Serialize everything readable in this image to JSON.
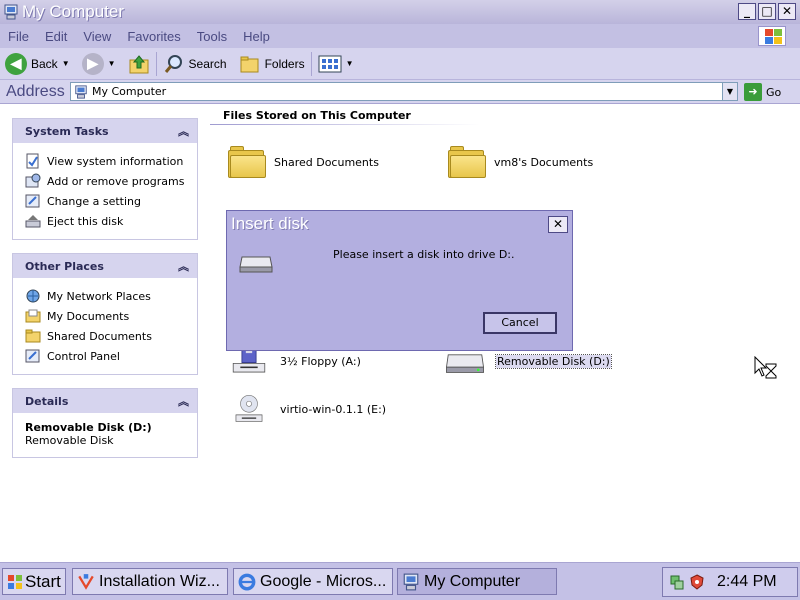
{
  "window": {
    "title": "My Computer",
    "controls": [
      "_",
      "□",
      "✕"
    ]
  },
  "menu": {
    "items": [
      "File",
      "Edit",
      "View",
      "Favorites",
      "Tools",
      "Help"
    ]
  },
  "toolbar": {
    "back_label": "Back",
    "search_label": "Search",
    "folders_label": "Folders"
  },
  "address": {
    "label": "Address",
    "value": "My Computer",
    "go_label": "Go"
  },
  "sidebar": {
    "system_tasks": {
      "title": "System Tasks",
      "items": [
        "View system information",
        "Add or remove programs",
        "Change a setting",
        "Eject this disk"
      ]
    },
    "other_places": {
      "title": "Other Places",
      "items": [
        "My Network Places",
        "My Documents",
        "Shared Documents",
        "Control Panel"
      ]
    },
    "details": {
      "title": "Details",
      "name": "Removable Disk (D:)",
      "type": "Removable Disk"
    }
  },
  "content": {
    "section_files": "Files Stored on This Computer",
    "folders": [
      "Shared Documents",
      "vm8's Documents"
    ],
    "drives": [
      "3½ Floppy (A:)",
      "Removable Disk (D:)",
      "virtio-win-0.1.1 (E:)"
    ]
  },
  "dialog": {
    "title": "Insert disk",
    "message": "Please insert a disk into drive D:.",
    "cancel_label": "Cancel",
    "close": "✕"
  },
  "taskbar": {
    "start_label": "Start",
    "tasks": [
      "Installation Wiz...",
      "Google - Micros...",
      "My Computer"
    ],
    "clock": "2:44 PM"
  }
}
